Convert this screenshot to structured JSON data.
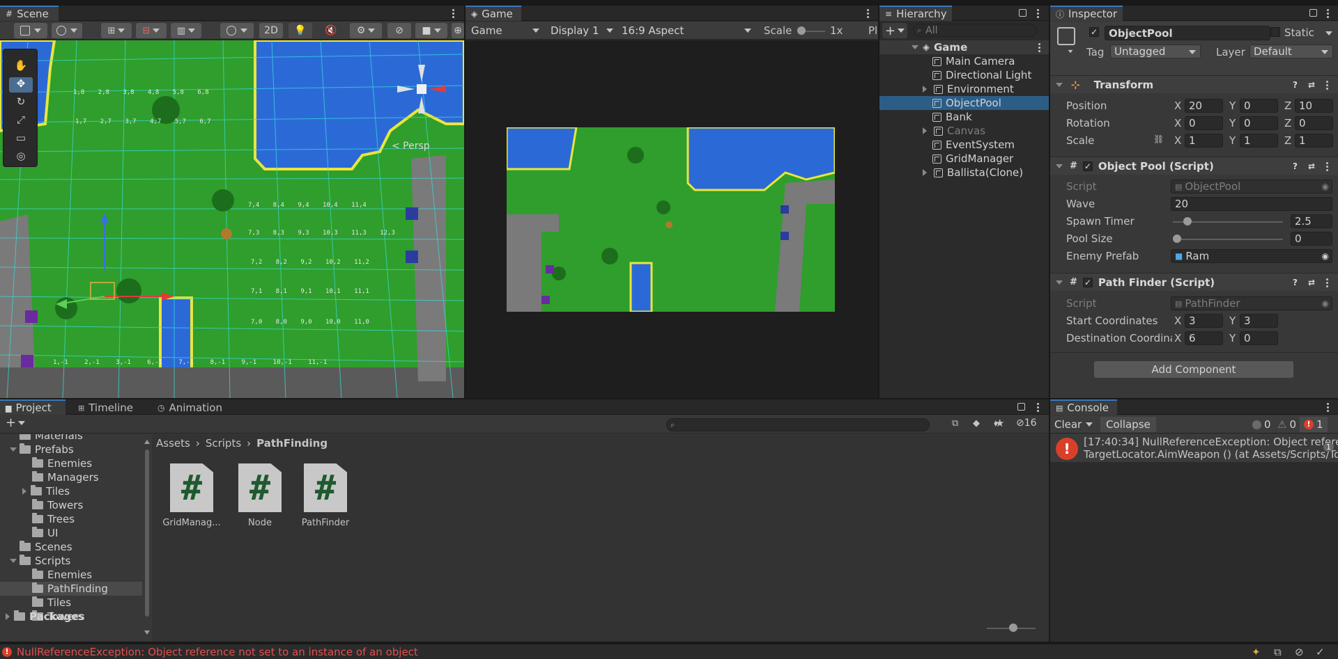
{
  "scene": {
    "tab_label": "Scene",
    "toolbar": {
      "btn_2d": "2D"
    },
    "gizmo_label": "< Persp"
  },
  "game": {
    "tab_label": "Game",
    "display_mode": "Game",
    "display": "Display 1",
    "aspect": "16:9 Aspect",
    "scale_label": "Scale",
    "scale_value": "1x",
    "play_label": "Pl"
  },
  "hierarchy": {
    "tab_label": "Hierarchy",
    "search_placeholder": "All",
    "root": "Game",
    "items": [
      {
        "label": "Main Camera",
        "expandable": false,
        "selected": false,
        "dim": false
      },
      {
        "label": "Directional Light",
        "expandable": false,
        "selected": false,
        "dim": false
      },
      {
        "label": "Environment",
        "expandable": true,
        "selected": false,
        "dim": false
      },
      {
        "label": "ObjectPool",
        "expandable": false,
        "selected": true,
        "dim": false
      },
      {
        "label": "Bank",
        "expandable": false,
        "selected": false,
        "dim": false
      },
      {
        "label": "Canvas",
        "expandable": true,
        "selected": false,
        "dim": true
      },
      {
        "label": "EventSystem",
        "expandable": false,
        "selected": false,
        "dim": false
      },
      {
        "label": "GridManager",
        "expandable": false,
        "selected": false,
        "dim": false
      },
      {
        "label": "Ballista(Clone)",
        "expandable": true,
        "selected": false,
        "dim": false
      }
    ]
  },
  "inspector": {
    "tab_label": "Inspector",
    "object_name": "ObjectPool",
    "static_label": "Static",
    "tag_label": "Tag",
    "tag_value": "Untagged",
    "layer_label": "Layer",
    "layer_value": "Default",
    "transform": {
      "title": "Transform",
      "rows": [
        {
          "label": "Position",
          "x": "20",
          "y": "0",
          "z": "10"
        },
        {
          "label": "Rotation",
          "x": "0",
          "y": "0",
          "z": "0"
        },
        {
          "label": "Scale",
          "x": "1",
          "y": "1",
          "z": "1"
        }
      ]
    },
    "object_pool": {
      "title": "Object Pool (Script)",
      "script_label": "Script",
      "script_value": "ObjectPool",
      "wave_label": "Wave",
      "wave_value": "20",
      "spawn_timer_label": "Spawn Timer",
      "spawn_timer_value": "2.5",
      "spawn_timer_fraction": 0.1,
      "pool_size_label": "Pool Size",
      "pool_size_value": "0",
      "pool_size_fraction": 0.0,
      "enemy_prefab_label": "Enemy Prefab",
      "enemy_prefab_value": "Ram"
    },
    "path_finder": {
      "title": "Path Finder (Script)",
      "script_label": "Script",
      "script_value": "PathFinder",
      "start_label": "Start Coordinates",
      "start_x": "3",
      "start_y": "3",
      "dest_label": "Destination Coordina",
      "dest_x": "6",
      "dest_y": "0"
    },
    "add_component": "Add Component"
  },
  "project": {
    "tabs": [
      "Project",
      "Timeline",
      "Animation"
    ],
    "tree": [
      {
        "label": "Materials",
        "indent": 1,
        "arrow": "none"
      },
      {
        "label": "Prefabs",
        "indent": 1,
        "arrow": "down"
      },
      {
        "label": "Enemies",
        "indent": 2,
        "arrow": "none"
      },
      {
        "label": "Managers",
        "indent": 2,
        "arrow": "none"
      },
      {
        "label": "Tiles",
        "indent": 2,
        "arrow": "right"
      },
      {
        "label": "Towers",
        "indent": 2,
        "arrow": "none"
      },
      {
        "label": "Trees",
        "indent": 2,
        "arrow": "none"
      },
      {
        "label": "UI",
        "indent": 2,
        "arrow": "none"
      },
      {
        "label": "Scenes",
        "indent": 1,
        "arrow": "none"
      },
      {
        "label": "Scripts",
        "indent": 1,
        "arrow": "down"
      },
      {
        "label": "Enemies",
        "indent": 2,
        "arrow": "none"
      },
      {
        "label": "PathFinding",
        "indent": 2,
        "arrow": "none",
        "selected": true
      },
      {
        "label": "Tiles",
        "indent": 2,
        "arrow": "none"
      },
      {
        "label": "Towers",
        "indent": 2,
        "arrow": "none"
      }
    ],
    "packages": "Packages",
    "breadcrumb": [
      "Assets",
      "Scripts",
      "PathFinding"
    ],
    "assets": [
      "GridManag...",
      "Node",
      "PathFinder"
    ],
    "hidden_count": "16"
  },
  "console": {
    "tab_label": "Console",
    "clear": "Clear",
    "collapse": "Collapse",
    "info_count": "0",
    "warn_count": "0",
    "error_count": "1",
    "message_line1": "[17:40:34] NullReferenceException: Object referen",
    "message_line2": "TargetLocator.AimWeapon () (at Assets/Scripts/Tow",
    "message_count": "1"
  },
  "status_bar": {
    "message": "NullReferenceException: Object reference not set to an instance of an object"
  },
  "grid_labels": {
    "row1": [
      "1,8",
      "2,8",
      "3,8",
      "4,8",
      "5,8",
      "6,8"
    ],
    "row2": [
      "1,7",
      "2,7",
      "3,7",
      "4,7",
      "5,7",
      "6,7"
    ],
    "row3": [
      "7,4",
      "8,4",
      "9,4",
      "10,4",
      "11,4"
    ],
    "row4": [
      "7,3",
      "8,3",
      "9,3",
      "10,3",
      "11,3",
      "12,3"
    ],
    "row5": [
      "7,2",
      "8,2",
      "9,2",
      "10,2",
      "11,2"
    ],
    "row6": [
      "7,1",
      "8,1",
      "9,1",
      "10,1",
      "11,1"
    ],
    "row7": [
      "7,0",
      "8,0",
      "9,0",
      "10,0",
      "11,0"
    ],
    "row8": [
      "1,-1",
      "2,-1",
      "3,-1",
      "6,-1",
      "7,-1",
      "8,-1",
      "9,-1",
      "10,-1",
      "11,-1"
    ]
  },
  "colors": {
    "accent": "#3a79bb",
    "selection": "#2c5d87",
    "grass": "#2f9e2c",
    "water": "#2b6ad6",
    "error": "#d9402a"
  }
}
